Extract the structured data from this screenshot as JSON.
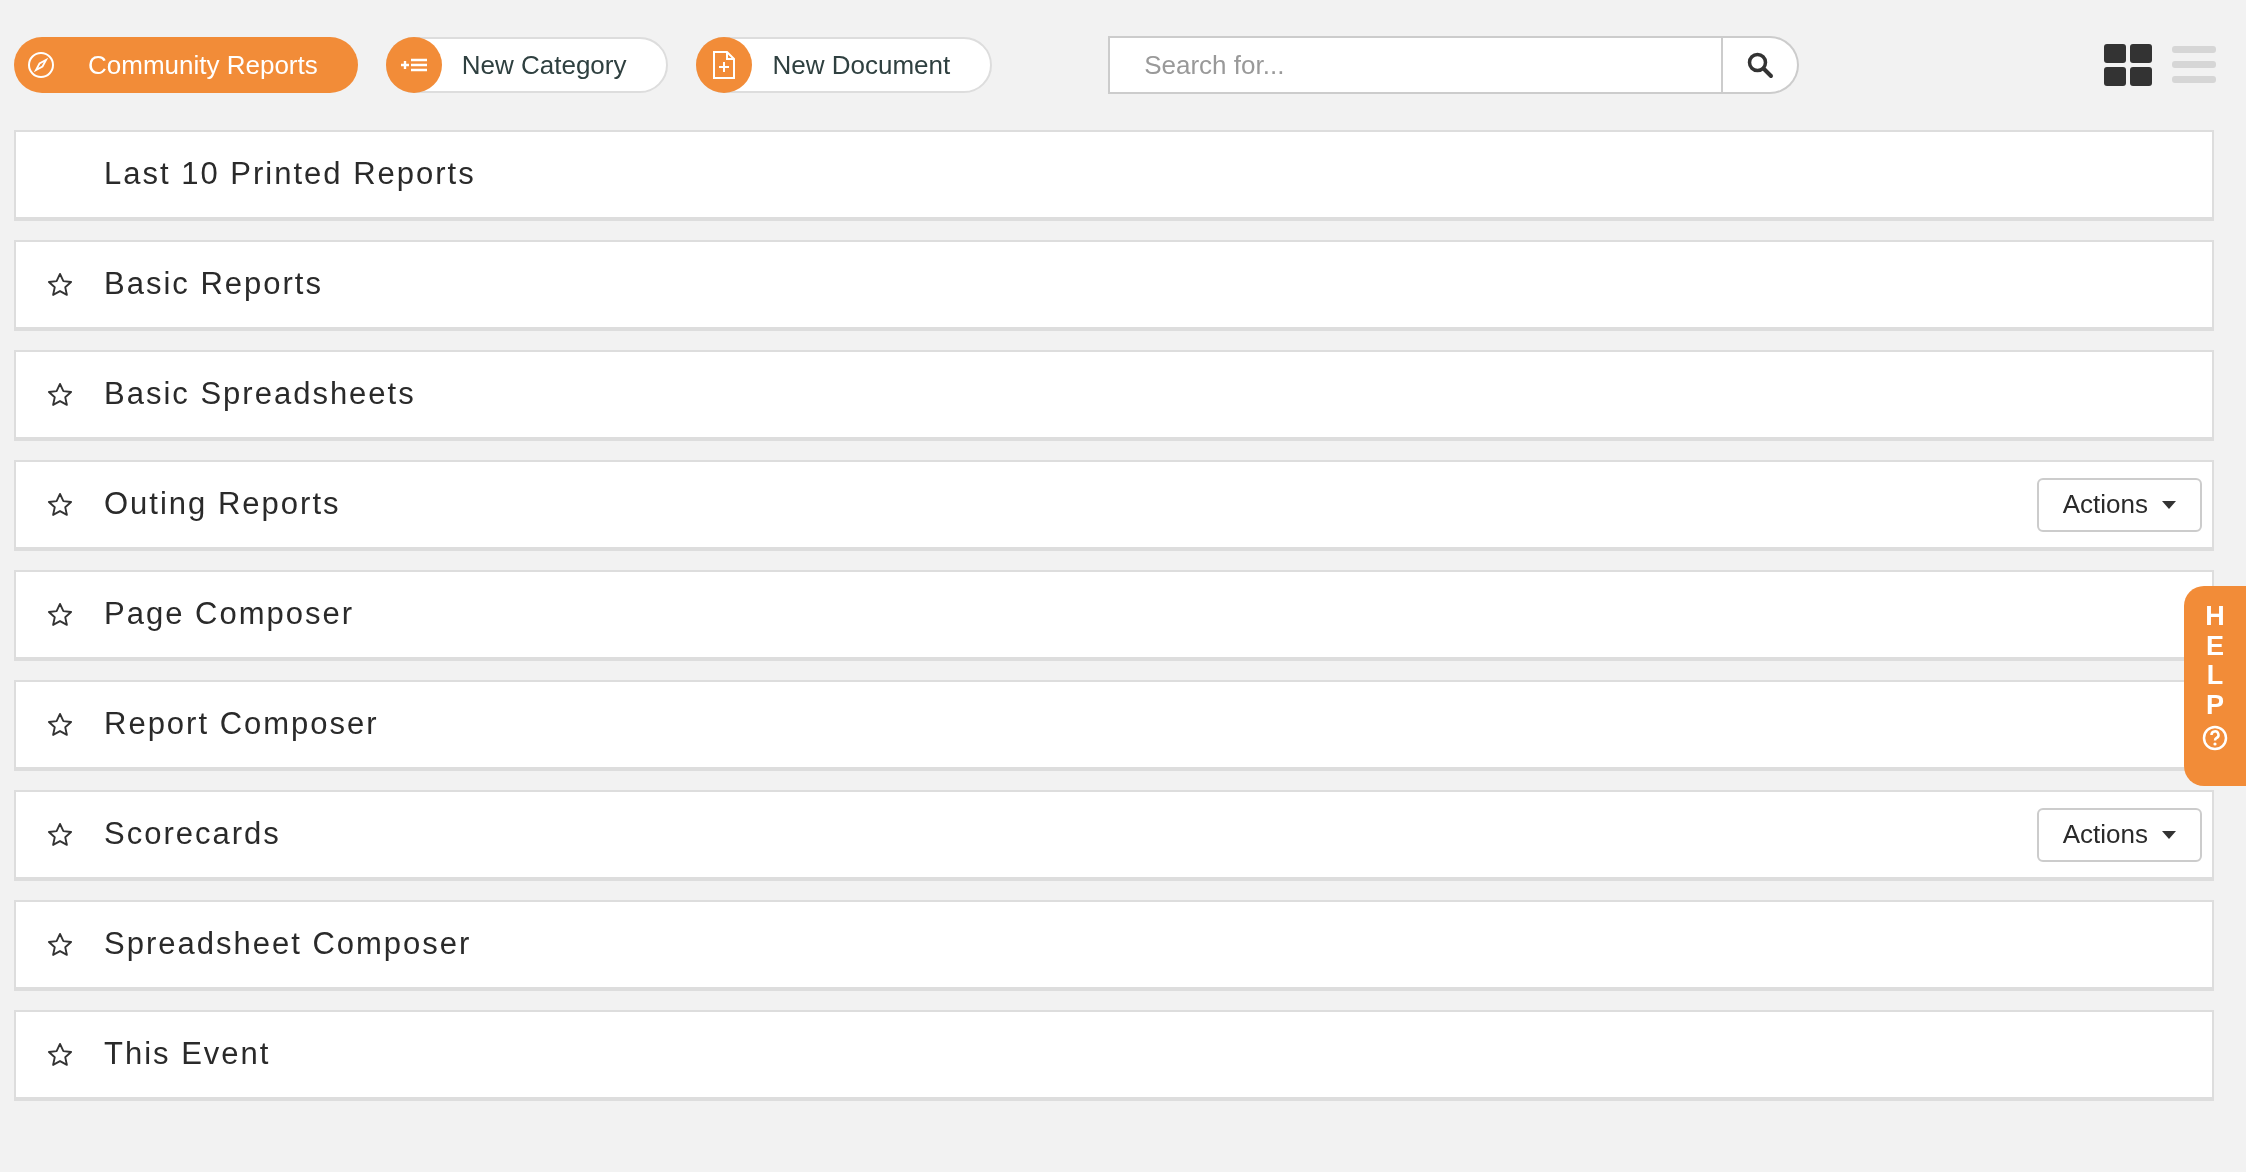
{
  "toolbar": {
    "buttons": [
      {
        "label": "Community Reports",
        "kind": "compass",
        "selected": true
      },
      {
        "label": "New Category",
        "kind": "add-list",
        "selected": false
      },
      {
        "label": "New Document",
        "kind": "add-file",
        "selected": false
      }
    ],
    "search": {
      "placeholder": "Search for..."
    },
    "view_toggle": [
      {
        "kind": "grid",
        "selected": true
      },
      {
        "kind": "list",
        "selected": false
      }
    ]
  },
  "rows": [
    {
      "label": "Last 10 Printed Reports",
      "kind": "recent"
    },
    {
      "label": "Basic Reports",
      "kind": "category",
      "favorite": false
    },
    {
      "label": "Basic Spreadsheets",
      "kind": "category",
      "favorite": false
    },
    {
      "label": "Outing Reports",
      "kind": "category",
      "favorite": false,
      "actions": "Actions"
    },
    {
      "label": "Page Composer",
      "kind": "category",
      "favorite": false
    },
    {
      "label": "Report Composer",
      "kind": "category",
      "favorite": false
    },
    {
      "label": "Scorecards",
      "kind": "category",
      "favorite": false,
      "actions": "Actions"
    },
    {
      "label": "Spreadsheet Composer",
      "kind": "category",
      "favorite": false
    },
    {
      "label": "This Event",
      "kind": "category",
      "favorite": false
    }
  ],
  "help_tab": {
    "label": "HELP"
  }
}
